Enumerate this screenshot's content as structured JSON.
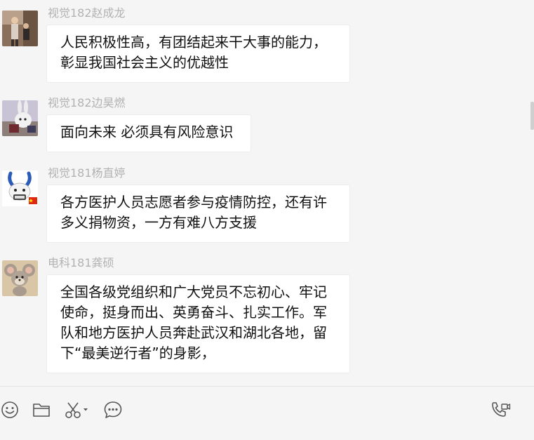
{
  "messages": [
    {
      "sender": "视觉182赵成龙",
      "avatar_icon": "person-photo-avatar",
      "text": "人民积极性高，有团结起来干大事的能力，\n彰显我国社会主义的优越性"
    },
    {
      "sender": "视觉182边昊燃",
      "avatar_icon": "rabbit-plush-avatar",
      "text": "面向未来 必须具有风险意识"
    },
    {
      "sender": "视觉181杨直婷",
      "avatar_icon": "cartoon-bunny-flag-avatar",
      "text": "各方医护人员志愿者参与疫情防控，还有许\n多义捐物资，一方有难八方支援"
    },
    {
      "sender": "电科181龚硕",
      "avatar_icon": "cartoon-mouse-avatar",
      "text": "全国各级党组织和广大党员不忘初心、牢记\n使命，挺身而出、英勇奋斗、扎实工作。军\n队和地方医护人员奔赴武汉和湖北各地，留\n下“最美逆行者”的身影，"
    }
  ],
  "toolbar": {
    "icons": [
      "emoji-icon",
      "folder-icon",
      "screenshot-scissors-icon",
      "chat-history-icon",
      "video-call-icon"
    ]
  },
  "colors": {
    "chat_background": "#f5f5f5",
    "bubble_background": "#ffffff",
    "sender_name": "#b2b2b2",
    "message_text": "#111111",
    "icon": "#555555"
  }
}
